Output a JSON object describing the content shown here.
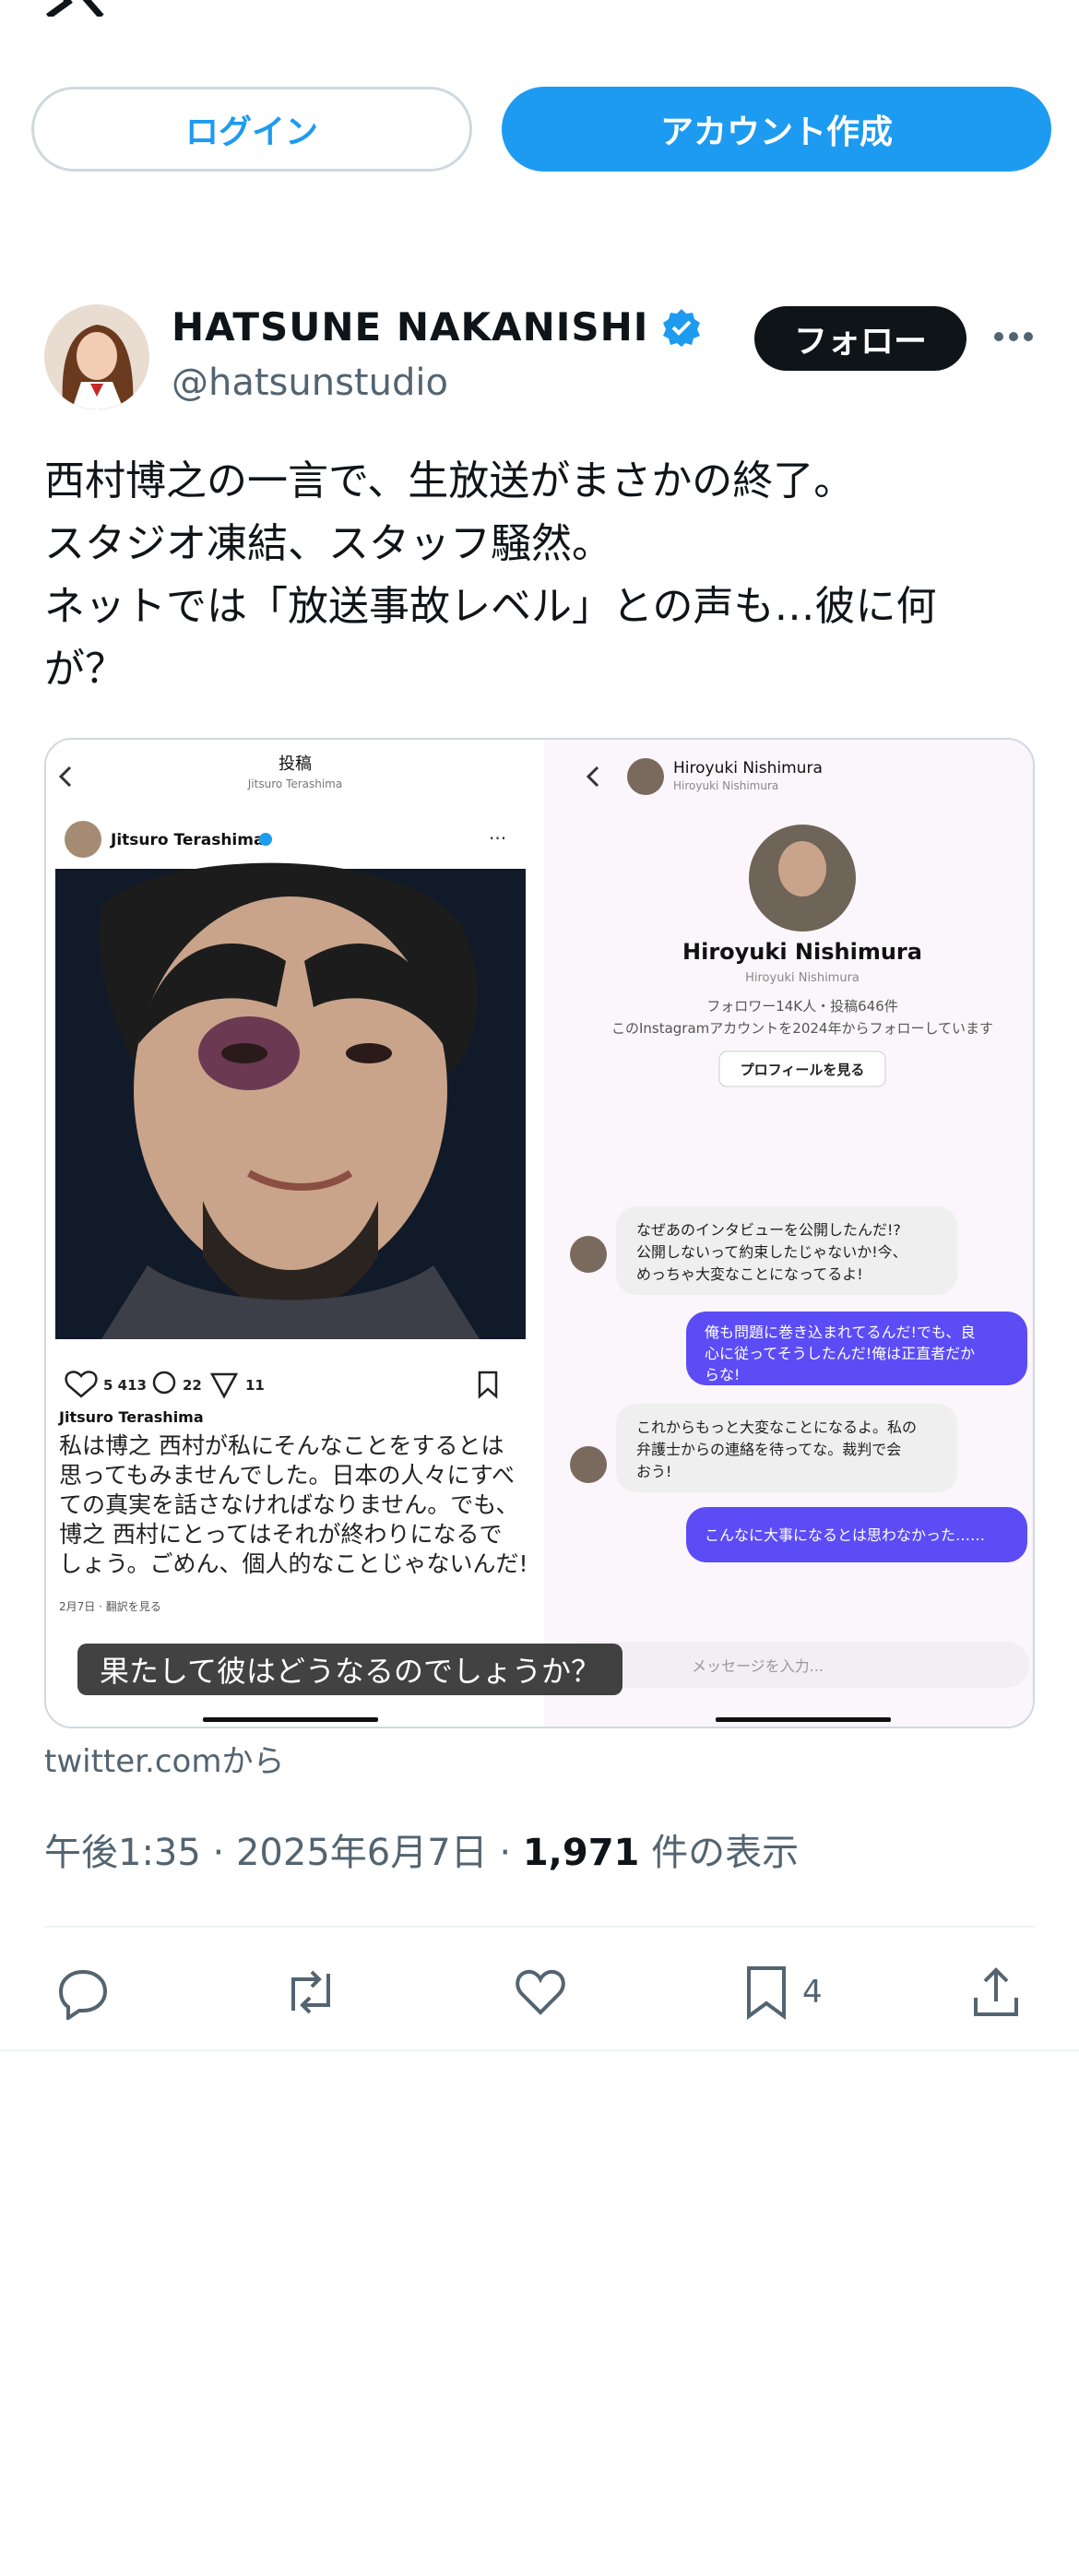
{
  "header": {
    "logo_icon": "x-logo-icon",
    "login_label": "ログイン",
    "signup_label": "アカウント作成"
  },
  "user": {
    "name": "HATSUNE NAKANISHI",
    "handle": "@hatsunstudio",
    "verified_icon": "verified-badge-icon",
    "follow_label": "フォロー",
    "more_icon": "more-icon"
  },
  "tweet": {
    "lines": [
      "西村博之の一言で、生放送がまさかの終了。",
      "スタジオ凍結、スタッフ騒然。",
      "ネットでは「放送事故レベル」との声も…彼に何",
      "が？"
    ]
  },
  "media": {
    "caption": "果たして彼はどうなるのでしょうか？",
    "left_panel": {
      "header_title": "投稿",
      "header_sub": "Jitsuro Terashima",
      "author": "Jitsuro Terashima",
      "likes": "5 413",
      "comments": "22",
      "shares": "11",
      "caption_author": "Jitsuro Terashima",
      "caption_lines": [
        "私は博之 西村が私にそんなことをするとは",
        "思ってもみませんでした。日本の人々にすべ",
        "ての真実を話さなければなりません。でも、",
        "博之 西村にとってはそれが終わりになるで",
        "しょう。ごめん、個人的なことじゃないんだ!"
      ],
      "date": "2月7日 · 翻訳を見る"
    },
    "right_panel": {
      "header_name": "Hiroyuki Nishimura",
      "header_sub": "Hiroyuki Nishimura",
      "profile_name": "Hiroyuki Nishimura",
      "profile_sub": "Hiroyuki Nishimura",
      "stats": "フォロワー14K人・投稿646件",
      "follow_note": "このInstagramアカウントを2024年からフォローしています",
      "view_profile": "プロフィールを見る",
      "messages": [
        {
          "from": "them",
          "lines": [
            "なぜあのインタビューを公開したんだ!?",
            "公開しないって約束したじゃないか!今、",
            "めっちゃ大変なことになってるよ!"
          ]
        },
        {
          "from": "me",
          "lines": [
            "俺も問題に巻き込まれてるんだ!でも、良",
            "心に従ってそうしたんだ!俺は正直者だか",
            "らな!"
          ]
        },
        {
          "from": "them",
          "lines": [
            "これからもっと大変なことになるよ。私の",
            "弁護士からの連絡を待ってな。裁判で会",
            "おう!"
          ]
        },
        {
          "from": "me",
          "lines": [
            "こんなに大事になるとは思わなかった……"
          ]
        }
      ],
      "input_placeholder": "メッセージを入力..."
    }
  },
  "source": "twitter.comから",
  "meta": {
    "time": "午後1:35",
    "sep1": " · ",
    "date": "2025年6月7日",
    "sep2": " · ",
    "views": "1,971",
    "views_label": " 件の表示"
  },
  "actions": {
    "reply_icon": "reply-icon",
    "retweet_icon": "retweet-icon",
    "like_icon": "heart-icon",
    "bookmark_icon": "bookmark-icon",
    "bookmark_count": "4",
    "share_icon": "share-icon"
  },
  "colors": {
    "accent": "#1d9bf0",
    "text": "#0f1419",
    "muted": "#536471",
    "dm_bubble_me": "#5b4cf5",
    "dm_bubble_them": "#efefef"
  }
}
